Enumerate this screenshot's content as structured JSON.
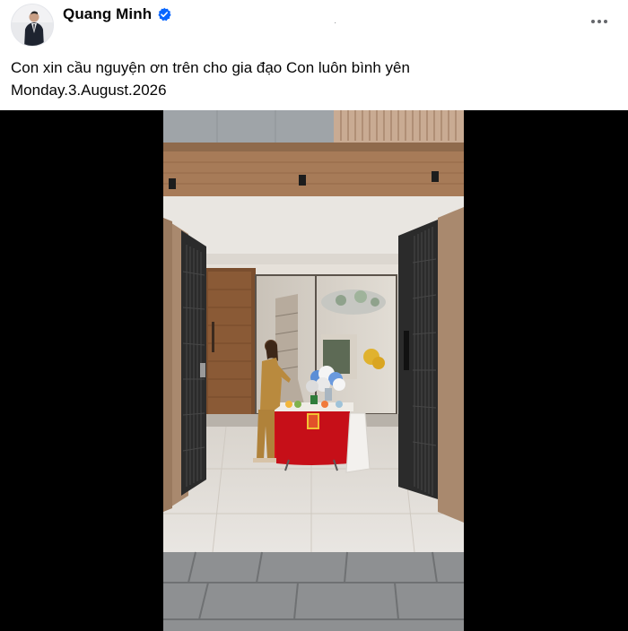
{
  "post": {
    "author": {
      "name": "Quang Minh",
      "verified": true,
      "avatar_icon": "profile-photo"
    },
    "subline_text": "·",
    "more_icon": "more-options-icon",
    "caption": {
      "line1": "Con xin cầu nguyện ơn trên cho gia đạo Con luôn bình yên",
      "line2": "Monday.3.August.2026"
    }
  },
  "media": {
    "type": "video",
    "scene_description_icon": "video-frame"
  },
  "colors": {
    "verified_blue": "#0866ff",
    "text_primary": "#050505",
    "text_secondary": "#65676b",
    "media_background": "#000000",
    "tablecloth_red": "#d9121c"
  }
}
